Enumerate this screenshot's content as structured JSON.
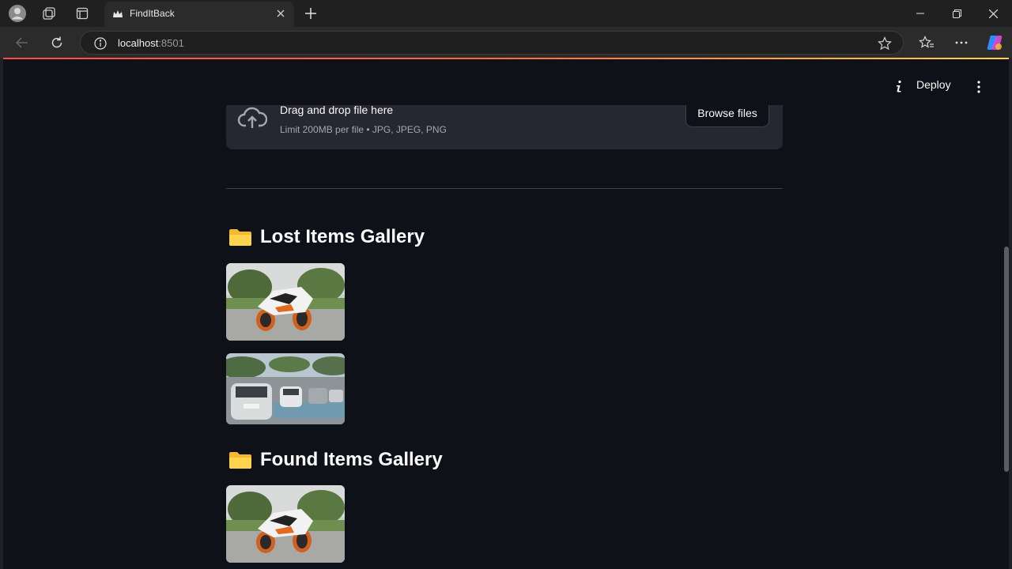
{
  "browser": {
    "tab_title": "FindItBack",
    "url_host": "localhost",
    "url_port": ":8501"
  },
  "app": {
    "deploy_label": "Deploy"
  },
  "uploader": {
    "title": "Drag and drop file here",
    "limit": "Limit 200MB per file • JPG, JPEG, PNG",
    "browse_label": "Browse files"
  },
  "lost_gallery": {
    "title": "Lost Items Gallery",
    "images": [
      "motorcycle-photo",
      "parked-cars-photo"
    ]
  },
  "found_gallery": {
    "title": "Found Items Gallery",
    "images": [
      "motorcycle-photo"
    ]
  },
  "colors": {
    "page_bg": "#0e1117",
    "accent_red": "#ff4b4b",
    "folder_yellow": "#f9c94a"
  }
}
